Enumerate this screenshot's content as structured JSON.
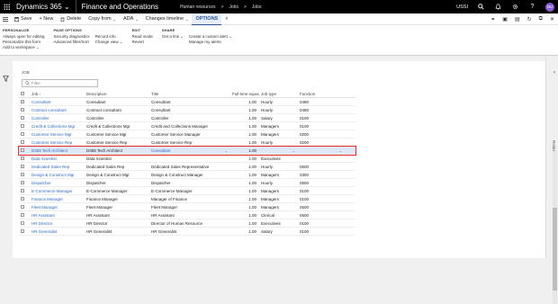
{
  "topbar": {
    "app_name": "Dynamics 365",
    "app_caret": "⌄",
    "module": "Finance and Operations",
    "breadcrumbs": [
      "Human resources",
      ">",
      "Jobs",
      ">",
      "Jobs"
    ],
    "company": "USSI",
    "icons": [
      "search-icon",
      "bell-icon",
      "gear-icon",
      "help-icon"
    ],
    "avatar_initials": "DU"
  },
  "actionbar": {
    "items": [
      {
        "label": "Save",
        "icon": "save-icon"
      },
      {
        "label": "+ New"
      },
      {
        "label": "Delete",
        "icon": "delete-icon"
      },
      {
        "label": "Copy from",
        "caret": true
      },
      {
        "label": "ADA",
        "caret": true
      },
      {
        "label": "Changes timeline",
        "caret": true
      },
      {
        "label": "OPTIONS",
        "active": true
      },
      {
        "label": "⌕"
      }
    ]
  },
  "ribbon": {
    "groups": [
      {
        "title": "PERSONALIZE",
        "cols": [
          [
            "Always open for editing",
            "Personalize this form",
            "Add to workspace ⌄"
          ]
        ]
      },
      {
        "title": "PAGE OPTIONS",
        "cols": [
          [
            "Security diagnostics",
            "Advanced filter/Sort"
          ],
          [
            "Record info",
            "Change view ⌄"
          ]
        ]
      },
      {
        "title": "EDIT",
        "cols": [
          [
            "Read mode",
            "Revert"
          ]
        ]
      },
      {
        "title": "SHARE",
        "cols": [
          [
            "Get a link ⌄"
          ],
          [
            "Create a custom alert ⌄",
            "Manage my alerts"
          ]
        ]
      }
    ]
  },
  "content": {
    "section_title": "JOB",
    "filter_placeholder": "Filter"
  },
  "grid": {
    "columns": [
      "Job ↑",
      "Description",
      "Title",
      "Full-time equiva...",
      "Job type",
      "Function"
    ],
    "rows": [
      {
        "job": "Consultant",
        "desc": "Consultant",
        "title": "Consultant",
        "fte": "1.00",
        "type": "Hourly",
        "func": "0480"
      },
      {
        "job": "Contract consultant",
        "desc": "Contract consultant",
        "title": "Consultant",
        "fte": "1.00",
        "type": "Hourly",
        "func": "0480"
      },
      {
        "job": "Controller",
        "desc": "Controller",
        "title": "Controller",
        "fte": "1.00",
        "type": "Salary",
        "func": "0100"
      },
      {
        "job": "Credit & Collections Mgr",
        "desc": "Credit & Collections Mgr",
        "title": "Credit and Collections Manager",
        "fte": "1.00",
        "type": "Managers",
        "func": "0100"
      },
      {
        "job": "Customer Service Mgr",
        "desc": "Customer Service Mgr",
        "title": "Customer Service Manager",
        "fte": "1.00",
        "type": "Managers",
        "func": "0200"
      },
      {
        "job": "Customer Service Rep",
        "desc": "Customer Service Rep",
        "title": "Customer Service Rep",
        "fte": "1.00",
        "type": "Hourly",
        "func": "0200"
      },
      {
        "job": "D365 Tech Architect",
        "desc": "D365 Tech Architect",
        "title": "Consultant",
        "fte": "1.00",
        "type": "",
        "func": "",
        "selected": true
      },
      {
        "job": "Data Scientist",
        "desc": "Data Scientist",
        "title": "",
        "fte": "1.00",
        "type": "Executives",
        "func": ""
      },
      {
        "job": "Dedicated Sales Rep",
        "desc": "Dedicated Sales Rep",
        "title": "Dedicated Sales Representative",
        "fte": "1.00",
        "type": "Hourly",
        "func": "0600"
      },
      {
        "job": "Design & Construct Mgr",
        "desc": "Design & Construct Mgr",
        "title": "Design & Construct Manager",
        "fte": "1.00",
        "type": "Managers",
        "func": "0300"
      },
      {
        "job": "Dispatcher",
        "desc": "Dispatcher",
        "title": "Dispatcher",
        "fte": "1.00",
        "type": "Hourly",
        "func": "0500"
      },
      {
        "job": "E-Commerce Manager",
        "desc": "E-Commerce Manager",
        "title": "E-Commerce Manager",
        "fte": "1.00",
        "type": "Managers",
        "func": "0100"
      },
      {
        "job": "Finance Manager",
        "desc": "Finance Manager",
        "title": "Manager of Finance",
        "fte": "1.00",
        "type": "Managers",
        "func": "0100"
      },
      {
        "job": "Fleet Manager",
        "desc": "Fleet Manager",
        "title": "Fleet Manager",
        "fte": "1.00",
        "type": "Managers",
        "func": "0500"
      },
      {
        "job": "HR Assistant",
        "desc": "HR Assistant",
        "title": "HR Assistant",
        "fte": "1.00",
        "type": "Clerical",
        "func": "0500"
      },
      {
        "job": "HR Director",
        "desc": "HR Director",
        "title": "Director of Human Resource",
        "fte": "1.00",
        "type": "Executives",
        "func": "0100"
      },
      {
        "job": "HR Generalist",
        "desc": "HR Generalist",
        "title": "HR Generalist",
        "fte": "1.00",
        "type": "Salary",
        "func": "0100"
      }
    ]
  },
  "right_panel": {
    "label": "Related information"
  },
  "colors": {
    "topbar": "#000000",
    "link": "#2b6cc4",
    "selection_outline": "#e32b2b",
    "avatar": "#8a5bd6"
  }
}
